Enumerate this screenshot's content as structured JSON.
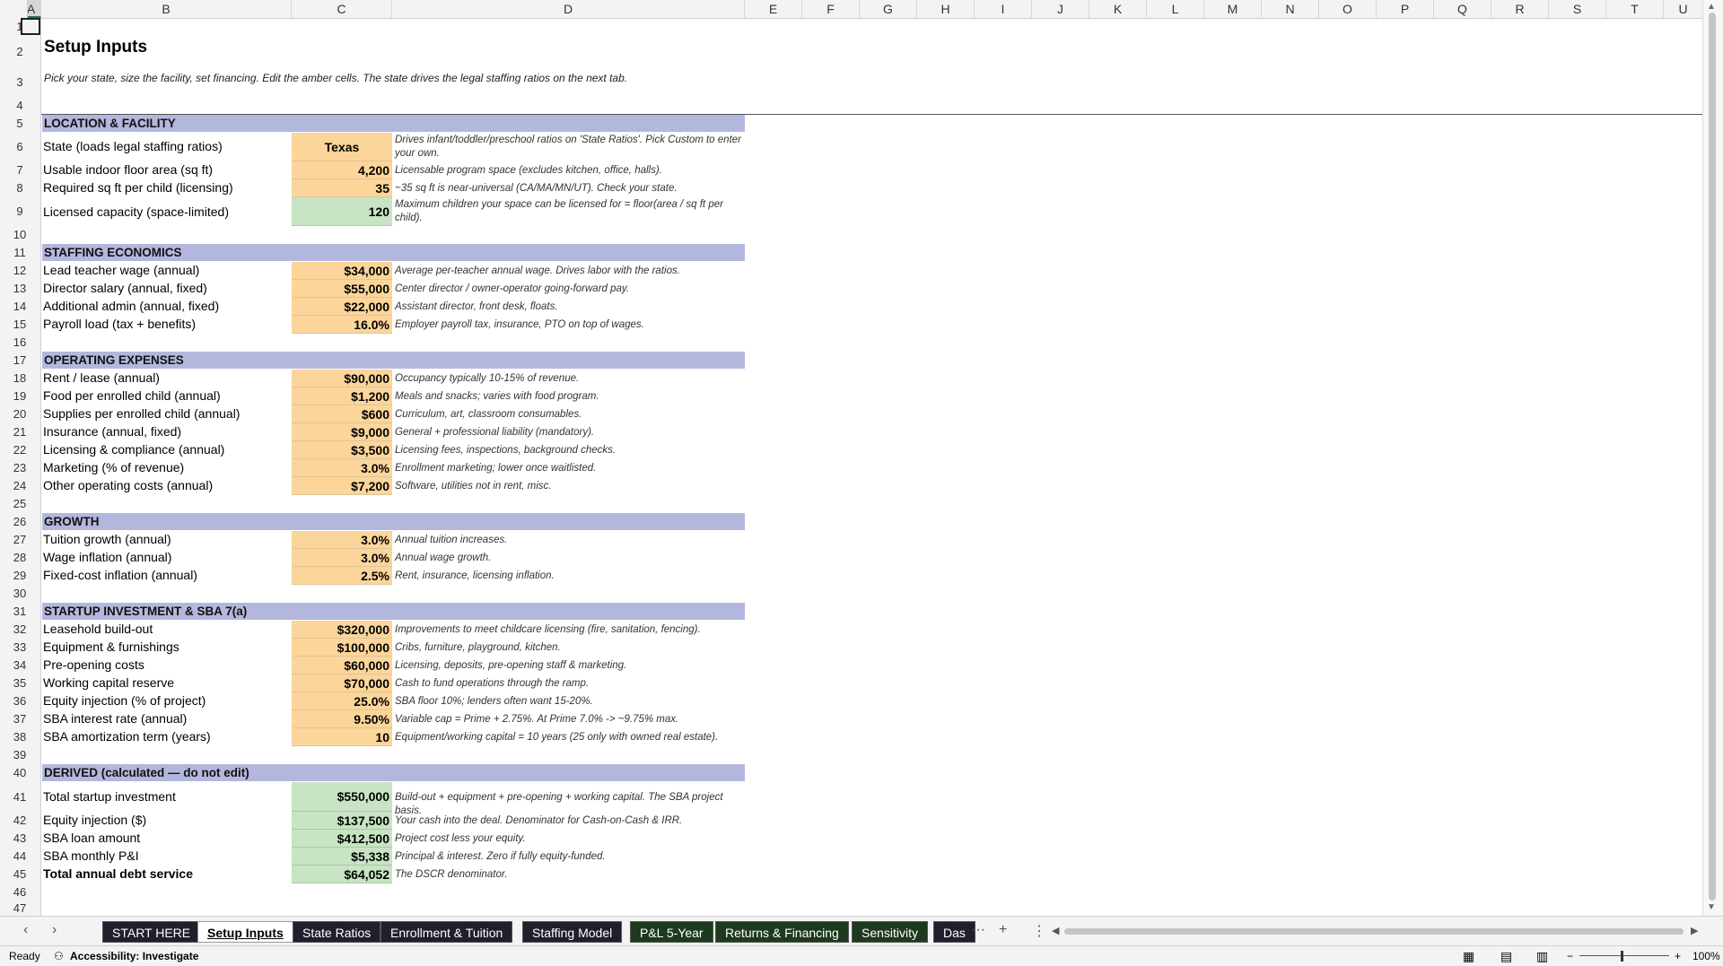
{
  "columns": [
    "A",
    "B",
    "C",
    "D",
    "E",
    "F",
    "G",
    "H",
    "I",
    "J",
    "K",
    "L",
    "M",
    "N",
    "O",
    "P",
    "Q",
    "R",
    "S",
    "T",
    "U"
  ],
  "rows": [
    "1",
    "2",
    "3",
    "4",
    "5",
    "6",
    "7",
    "8",
    "9",
    "10",
    "11",
    "12",
    "13",
    "14",
    "15",
    "16",
    "17",
    "18",
    "19",
    "20",
    "21",
    "22",
    "23",
    "24",
    "25",
    "26",
    "27",
    "28",
    "29",
    "30",
    "31",
    "32",
    "33",
    "34",
    "35",
    "36",
    "37",
    "38",
    "39",
    "40",
    "41",
    "42",
    "43",
    "44",
    "45",
    "46",
    "47"
  ],
  "sheet": {
    "title": "Setup Inputs",
    "subtitle": "Pick your state, size the facility, set financing. Edit the amber cells. The state drives the legal staffing ratios on the next tab.",
    "sections": {
      "location": "LOCATION & FACILITY",
      "staffing": "STAFFING ECONOMICS",
      "opex": "OPERATING EXPENSES",
      "growth": "GROWTH",
      "startup": "STARTUP INVESTMENT & SBA 7(a)",
      "derived": "DERIVED  (calculated — do not edit)"
    },
    "items": [
      {
        "label": "State (loads legal staffing ratios)",
        "value": "Texas",
        "note": "Drives infant/toddler/preschool ratios on 'State Ratios'. Pick Custom to enter your own."
      },
      {
        "label": "Usable indoor floor area (sq ft)",
        "value": "4,200",
        "note": "Licensable program space (excludes kitchen, office, halls)."
      },
      {
        "label": "Required sq ft per child (licensing)",
        "value": "35",
        "note": "~35 sq ft is near-universal (CA/MA/MN/UT). Check your state."
      },
      {
        "label": "Licensed capacity (space-limited)",
        "value": "120",
        "note": "Maximum children your space can be licensed for = floor(area / sq ft per child)."
      },
      {
        "label": "Lead teacher wage (annual)",
        "value": "$34,000",
        "note": "Average per-teacher annual wage. Drives labor with the ratios."
      },
      {
        "label": "Director salary (annual, fixed)",
        "value": "$55,000",
        "note": "Center director / owner-operator going-forward pay."
      },
      {
        "label": "Additional admin (annual, fixed)",
        "value": "$22,000",
        "note": "Assistant director, front desk, floats."
      },
      {
        "label": "Payroll load (tax + benefits)",
        "value": "16.0%",
        "note": "Employer payroll tax, insurance, PTO on top of wages."
      },
      {
        "label": "Rent / lease (annual)",
        "value": "$90,000",
        "note": "Occupancy typically 10-15% of revenue."
      },
      {
        "label": "Food per enrolled child (annual)",
        "value": "$1,200",
        "note": "Meals and snacks; varies with food program."
      },
      {
        "label": "Supplies per enrolled child (annual)",
        "value": "$600",
        "note": "Curriculum, art, classroom consumables."
      },
      {
        "label": "Insurance (annual, fixed)",
        "value": "$9,000",
        "note": "General + professional liability (mandatory)."
      },
      {
        "label": "Licensing & compliance (annual)",
        "value": "$3,500",
        "note": "Licensing fees, inspections, background checks."
      },
      {
        "label": "Marketing (% of revenue)",
        "value": "3.0%",
        "note": "Enrollment marketing; lower once waitlisted."
      },
      {
        "label": "Other operating costs (annual)",
        "value": "$7,200",
        "note": "Software, utilities not in rent, misc."
      },
      {
        "label": "Tuition growth (annual)",
        "value": "3.0%",
        "note": "Annual tuition increases."
      },
      {
        "label": "Wage inflation (annual)",
        "value": "3.0%",
        "note": "Annual wage growth."
      },
      {
        "label": "Fixed-cost inflation (annual)",
        "value": "2.5%",
        "note": "Rent, insurance, licensing inflation."
      },
      {
        "label": "Leasehold build-out",
        "value": "$320,000",
        "note": "Improvements to meet childcare licensing (fire, sanitation, fencing)."
      },
      {
        "label": "Equipment & furnishings",
        "value": "$100,000",
        "note": "Cribs, furniture, playground, kitchen."
      },
      {
        "label": "Pre-opening costs",
        "value": "$60,000",
        "note": "Licensing, deposits, pre-opening staff & marketing."
      },
      {
        "label": "Working capital reserve",
        "value": "$70,000",
        "note": "Cash to fund operations through the ramp."
      },
      {
        "label": "Equity injection (% of project)",
        "value": "25.0%",
        "note": "SBA floor 10%; lenders often want 15-20%."
      },
      {
        "label": "SBA interest rate (annual)",
        "value": "9.50%",
        "note": "Variable cap = Prime + 2.75%. At Prime 7.0% -> ~9.75% max."
      },
      {
        "label": "SBA amortization term (years)",
        "value": "10",
        "note": "Equipment/working capital = 10 years (25 only with owned real estate)."
      },
      {
        "label": "Total startup investment",
        "value": "$550,000",
        "note": "Build-out + equipment + pre-opening + working capital. The SBA project basis."
      },
      {
        "label": "Equity injection ($)",
        "value": "$137,500",
        "note": "Your cash into the deal. Denominator for Cash-on-Cash & IRR."
      },
      {
        "label": "SBA loan amount",
        "value": "$412,500",
        "note": "Project cost less your equity."
      },
      {
        "label": "SBA monthly P&I",
        "value": "$5,338",
        "note": "Principal & interest. Zero if fully equity-funded."
      },
      {
        "label": "Total annual debt service",
        "value": "$64,052",
        "note": "The DSCR denominator."
      }
    ]
  },
  "tabs": [
    "START HERE",
    "Setup Inputs",
    "State Ratios",
    "Enrollment & Tuition",
    "Staffing Model",
    "P&L 5-Year",
    "Returns & Financing",
    "Sensitivity",
    "Das"
  ],
  "status": {
    "ready": "Ready",
    "accessibility": "Accessibility: Investigate",
    "zoom": "100%"
  }
}
